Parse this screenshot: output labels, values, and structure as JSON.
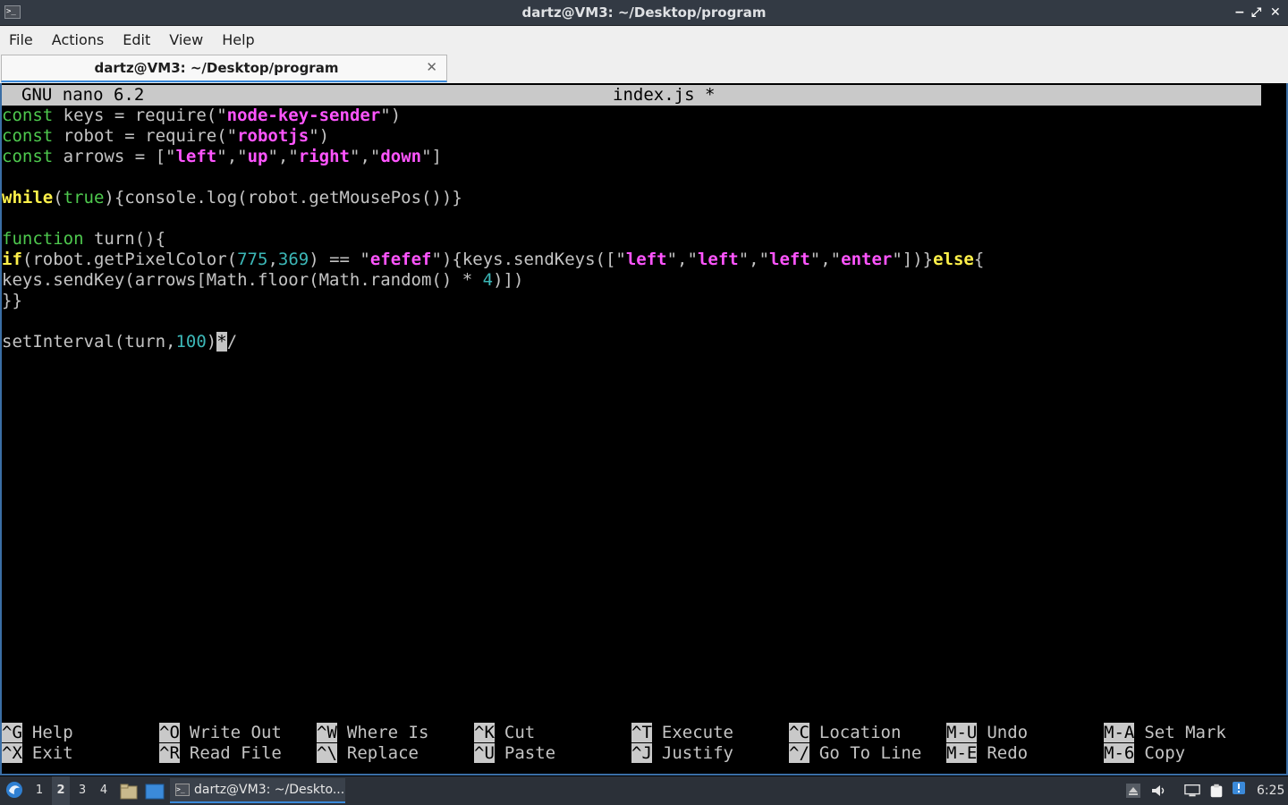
{
  "window": {
    "title": "dartz@VM3: ~/Desktop/program",
    "controls": [
      "−",
      "⤢",
      "✕"
    ]
  },
  "menu": [
    "File",
    "Actions",
    "Edit",
    "View",
    "Help"
  ],
  "tab": {
    "label": "dartz@VM3: ~/Desktop/program",
    "close": "✕"
  },
  "nano": {
    "version": "GNU nano 6.2",
    "filename": "index.js *",
    "code": {
      "l1": {
        "kw": "const",
        "a": " keys = require(\"",
        "s": "node-key-sender",
        "b": "\")"
      },
      "l2": {
        "kw": "const",
        "a": " robot = require(\"",
        "s": "robotjs",
        "b": "\")"
      },
      "l3": {
        "kw": "const",
        "a": " arrows = [\"",
        "s1": "left",
        "c1": "\",\"",
        "s2": "up",
        "c2": "\",\"",
        "s3": "right",
        "c3": "\",\"",
        "s4": "down",
        "b": "\"]"
      },
      "l5": {
        "ctl": "while",
        "a": "(",
        "kw": "true",
        "b": "){console.log(robot.getMousePos())}"
      },
      "l7": {
        "kw": "function",
        "a": " turn(){"
      },
      "l8": {
        "ctl": "if",
        "a": "(robot.getPixelColor(",
        "n1": "775",
        "c1": ",",
        "n2": "369",
        "b": ") == \"",
        "s1": "efefef",
        "c2": "\"){keys.sendKeys([\"",
        "s2": "left",
        "c3": "\",\"",
        "s3": "left",
        "c4": "\",\"",
        "s4": "left",
        "c5": "\",\"",
        "s5": "enter",
        "c6": "\"])}",
        "ctl2": "else",
        "d": "{"
      },
      "l9": {
        "a": "keys.sendKey(arrows[Math.floor(Math.random() * ",
        "n": "4",
        "b": ")])"
      },
      "l10": {
        "a": "}}"
      },
      "l12": {
        "a": "setInterval(turn,",
        "n": "100",
        "b": ")",
        "cursor": "*",
        "c": "/"
      }
    },
    "shortcuts": [
      {
        "key": "^G",
        "label": "Help"
      },
      {
        "key": "^X",
        "label": "Exit"
      },
      {
        "key": "^O",
        "label": "Write Out"
      },
      {
        "key": "^R",
        "label": "Read File"
      },
      {
        "key": "^W",
        "label": "Where Is"
      },
      {
        "key": "^\\",
        "label": "Replace"
      },
      {
        "key": "^K",
        "label": "Cut"
      },
      {
        "key": "^U",
        "label": "Paste"
      },
      {
        "key": "^T",
        "label": "Execute"
      },
      {
        "key": "^J",
        "label": "Justify"
      },
      {
        "key": "^C",
        "label": "Location"
      },
      {
        "key": "^/",
        "label": "Go To Line"
      },
      {
        "key": "M-U",
        "label": "Undo"
      },
      {
        "key": "M-E",
        "label": "Redo"
      },
      {
        "key": "M-A",
        "label": "Set Mark"
      },
      {
        "key": "M-6",
        "label": "Copy"
      }
    ]
  },
  "taskbar": {
    "workspaces": [
      "1",
      "2",
      "3",
      "4"
    ],
    "active_workspace": "2",
    "task_label": "dartz@VM3: ~/Deskto...",
    "clock": "6:25"
  },
  "colors": {
    "keyword": "#4ec94e",
    "string": "#ff55ff",
    "number": "#3cb8b8",
    "control": "#fff14a",
    "accent": "#3b8ad9"
  }
}
